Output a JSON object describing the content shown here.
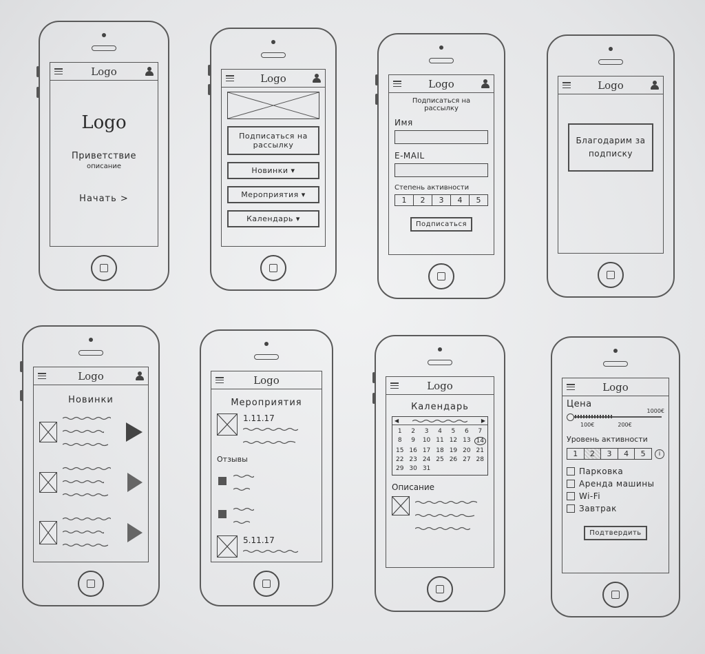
{
  "logo": "Logo",
  "screen1": {
    "logo_big": "Logo",
    "greeting": "Приветствие",
    "description": "описание",
    "start": "Начать >"
  },
  "screen2": {
    "buttons": [
      {
        "label": "Подписаться на рассылку"
      },
      {
        "label": "Новинки ▾"
      },
      {
        "label": "Мероприятия ▾"
      },
      {
        "label": "Календарь ▾"
      }
    ]
  },
  "screen3": {
    "title": "Подписаться на рассылку",
    "name_label": "Имя",
    "email_label": "E-MAIL",
    "activity_label": "Степень активности",
    "scale": [
      "1",
      "2",
      "3",
      "4",
      "5"
    ],
    "submit": "Подписаться"
  },
  "screen4": {
    "message": "Благодарим за подписку"
  },
  "screen5": {
    "title": "Новинки"
  },
  "screen6": {
    "title": "Мероприятия",
    "date1": "1.11.17",
    "reviews": "Отзывы",
    "date2": "5.11.17"
  },
  "screen7": {
    "title": "Календарь",
    "days": [
      "1",
      "2",
      "3",
      "4",
      "5",
      "6",
      "7",
      "8",
      "9",
      "10",
      "11",
      "12",
      "13",
      "14",
      "15",
      "16",
      "17",
      "18",
      "19",
      "20",
      "21",
      "22",
      "23",
      "24",
      "25",
      "26",
      "27",
      "28",
      "29",
      "30",
      "31"
    ],
    "description": "Описание"
  },
  "screen8": {
    "price_label": "Цена",
    "price_min": "100€",
    "price_mid": "200€",
    "price_max": "1000€",
    "activity_label": "Уровень активности",
    "scale": [
      "1",
      "2",
      "3",
      "4",
      "5"
    ],
    "options": [
      {
        "label": "Парковка"
      },
      {
        "label": "Аренда машины"
      },
      {
        "label": "Wi-Fi"
      },
      {
        "label": "Завтрак"
      }
    ],
    "confirm": "Подтвердить"
  }
}
